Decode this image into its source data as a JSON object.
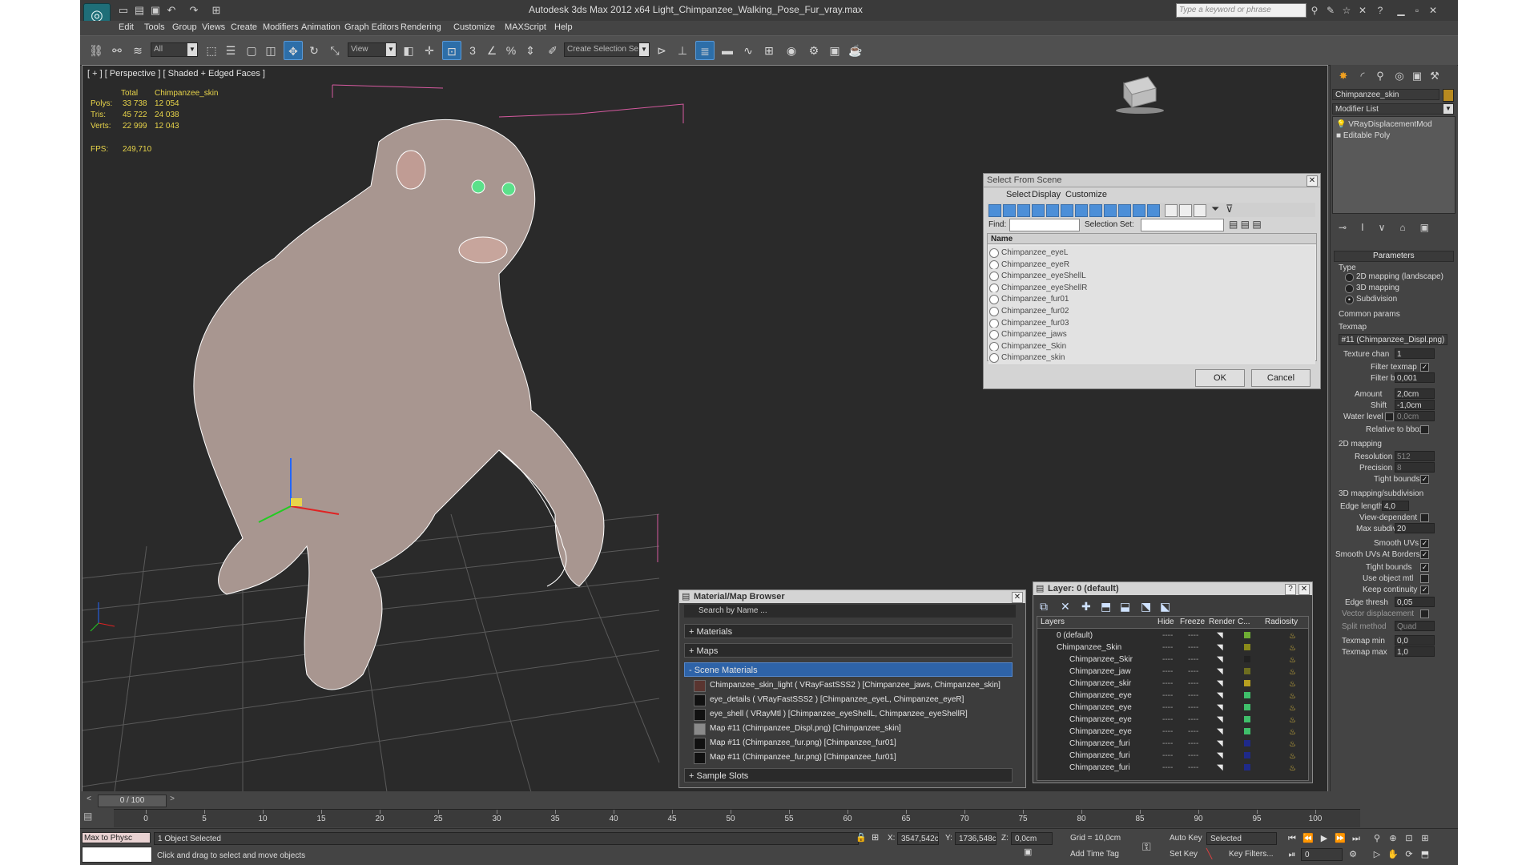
{
  "window": {
    "title": "Autodesk 3ds Max  2012 x64     Light_Chimpanzee_Walking_Pose_Fur_vray.max",
    "search_placeholder": "Type a keyword or phrase"
  },
  "menu": [
    "Edit",
    "Tools",
    "Group",
    "Views",
    "Create",
    "Modifiers",
    "Animation",
    "Graph Editors",
    "Rendering",
    "Customize",
    "MAXScript",
    "Help"
  ],
  "toolbar": {
    "filter": "All",
    "view": "View",
    "selection_set": "Create Selection Se"
  },
  "viewport": {
    "label": "[ + ] [ Perspective ] [ Shaded + Edged Faces ]",
    "stats": {
      "col_total": "Total",
      "col_object": "Chimpanzee_skin",
      "rows": [
        {
          "k": "Polys:",
          "t": "33 738",
          "o": "12 054"
        },
        {
          "k": "Tris:",
          "t": "45 722",
          "o": "24 038"
        },
        {
          "k": "Verts:",
          "t": "22 999",
          "o": "12 043"
        }
      ],
      "fps_label": "FPS:",
      "fps": "249,710"
    }
  },
  "select_from_scene": {
    "title": "Select From Scene",
    "menu": [
      "Select",
      "Display",
      "Customize"
    ],
    "find_label": "Find:",
    "selset_label": "Selection Set:",
    "col_name": "Name",
    "items": [
      "Chimpanzee_eyeL",
      "Chimpanzee_eyeR",
      "Chimpanzee_eyeShellL",
      "Chimpanzee_eyeShellR",
      "Chimpanzee_fur01",
      "Chimpanzee_fur02",
      "Chimpanzee_fur03",
      "Chimpanzee_jaws",
      "Chimpanzee_Skin",
      "Chimpanzee_skin"
    ],
    "ok": "OK",
    "cancel": "Cancel"
  },
  "material_browser": {
    "title": "Material/Map Browser",
    "search_placeholder": "Search by Name ...",
    "sections": {
      "materials": "+ Materials",
      "maps": "+ Maps",
      "scene": "- Scene Materials",
      "sample": "+ Sample Slots"
    },
    "items": [
      "Chimpanzee_skin_light  ( VRayFastSSS2 )  [Chimpanzee_jaws, Chimpanzee_skin]",
      "eye_details  ( VRayFastSSS2 )  [Chimpanzee_eyeL, Chimpanzee_eyeR]",
      "eye_shell  ( VRayMtl )  [Chimpanzee_eyeShellL, Chimpanzee_eyeShellR]",
      "Map #11 (Chimpanzee_Displ.png)  [Chimpanzee_skin]",
      "Map #11 (Chimpanzee_fur.png)  [Chimpanzee_fur01]",
      "Map #11 (Chimpanzee_fur.png)  [Chimpanzee_fur01]"
    ]
  },
  "layer_dialog": {
    "title": "Layer: 0 (default)",
    "cols": [
      "Layers",
      "Hide",
      "Freeze",
      "Render",
      "C...",
      "Radiosity"
    ],
    "rows": [
      {
        "name": "0 (default)",
        "color": "#6fae34",
        "indent": 0
      },
      {
        "name": "Chimpanzee_Skin",
        "color": "#8a8a1a",
        "indent": 0
      },
      {
        "name": "Chimpanzee_Skir",
        "color": "#222222",
        "indent": 1
      },
      {
        "name": "Chimpanzee_jaw",
        "color": "#6e6e20",
        "indent": 1
      },
      {
        "name": "Chimpanzee_skir",
        "color": "#b8a020",
        "indent": 1
      },
      {
        "name": "Chimpanzee_eye",
        "color": "#3fbf6a",
        "indent": 1
      },
      {
        "name": "Chimpanzee_eye",
        "color": "#3fbf6a",
        "indent": 1
      },
      {
        "name": "Chimpanzee_eye",
        "color": "#3fbf6a",
        "indent": 1
      },
      {
        "name": "Chimpanzee_eye",
        "color": "#3fbf6a",
        "indent": 1
      },
      {
        "name": "Chimpanzee_furi",
        "color": "#1f2a8a",
        "indent": 1
      },
      {
        "name": "Chimpanzee_furi",
        "color": "#1f2a8a",
        "indent": 1
      },
      {
        "name": "Chimpanzee_furi",
        "color": "#1f2a8a",
        "indent": 1
      }
    ]
  },
  "command_panel": {
    "object_name": "Chimpanzee_skin",
    "modifier_list": "Modifier List",
    "stack": [
      "VRayDisplacementMod",
      "Editable Poly"
    ],
    "rollout": "Parameters",
    "type_label": "Type",
    "types": [
      "2D mapping (landscape)",
      "3D mapping",
      "Subdivision"
    ],
    "common": "Common params",
    "texmap_label": "Texmap",
    "texmap": "#11 (Chimpanzee_Displ.png)",
    "texture_chan_label": "Texture chan",
    "texture_chan": "1",
    "filter_texmap": "Filter texmap",
    "filter_blur_label": "Filter blur",
    "filter_blur": "0,001",
    "amount_label": "Amount",
    "amount": "2,0cm",
    "shift_label": "Shift",
    "shift": "-1,0cm",
    "water_label": "Water level",
    "water": "0,0cm",
    "relative": "Relative to bbox",
    "map2d": "2D mapping",
    "resolution_label": "Resolution",
    "resolution": "512",
    "precision_label": "Precision",
    "precision": "8",
    "tight": "Tight bounds",
    "map3d": "3D mapping/subdivision",
    "edge_label": "Edge length",
    "edge": "4,0",
    "view_dep": "View-dependent",
    "max_sub_label": "Max subdivs",
    "max_sub": "20",
    "smooth_uv": "Smooth UVs",
    "smooth_uv_b": "Smooth UVs At Borders",
    "tight2": "Tight bounds",
    "use_obj": "Use object mtl",
    "keep": "Keep continuity",
    "edge_thresh_label": "Edge thresh",
    "edge_thresh": "0,05",
    "vector": "Vector displacement",
    "split_label": "Split method",
    "split": "Quad",
    "tmin_label": "Texmap min",
    "tmin": "0,0",
    "tmax_label": "Texmap max",
    "tmax": "1,0"
  },
  "timeline": {
    "frame": "0 / 100",
    "ticks": [
      "0",
      "5",
      "10",
      "15",
      "20",
      "25",
      "30",
      "35",
      "40",
      "45",
      "50",
      "55",
      "60",
      "65",
      "70",
      "75",
      "80",
      "85",
      "90",
      "95",
      "100"
    ]
  },
  "status": {
    "maxscript": "Max to Physc",
    "selected": "1 Object Selected",
    "prompt": "Click and drag to select and move objects",
    "x_label": "X:",
    "x": "3547,542c",
    "y_label": "Y:",
    "y": "1736,548c",
    "z_label": "Z:",
    "z": "0,0cm",
    "grid": "Grid = 10,0cm",
    "add_time_tag": "Add Time Tag",
    "auto_key": "Auto Key",
    "set_key": "Set Key",
    "key_mode": "Selected",
    "key_filters": "Key Filters...",
    "frame_value": "0"
  }
}
